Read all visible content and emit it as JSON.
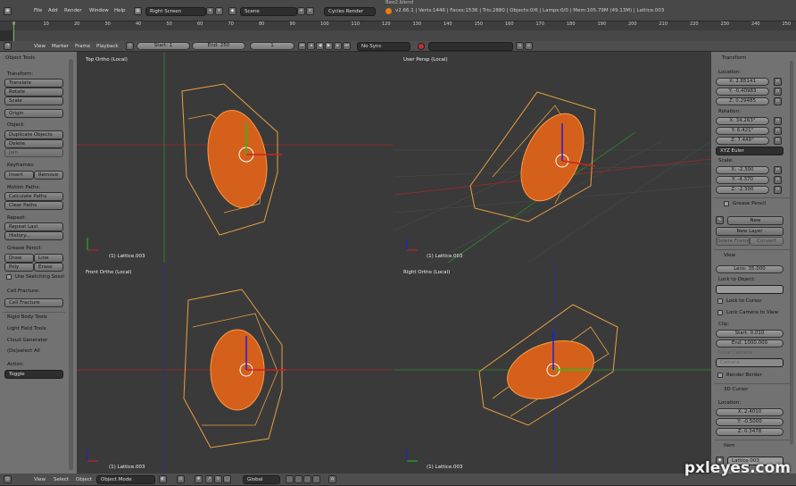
{
  "topbar": {
    "menus": [
      "File",
      "Add",
      "Render",
      "Window",
      "Help"
    ],
    "screen": "Right Screen",
    "scene": "Scene",
    "engine": "Cycles Render",
    "stats": "v2.66.1 | Verts:1446 | Faces:1536 | Tris:2880 | Objects:0/6 | Lamps:0/0 | Mem:105.79M (49.13M) | Lattice.003",
    "title": "Bee2.blend"
  },
  "timeline": {
    "ticks": [
      "0",
      "10",
      "20",
      "30",
      "40",
      "50",
      "60",
      "70",
      "80",
      "90",
      "100",
      "110",
      "120",
      "130",
      "140",
      "150",
      "160",
      "170",
      "180",
      "190",
      "200",
      "210",
      "220",
      "230",
      "240",
      "250"
    ],
    "menus": [
      "View",
      "Marker",
      "Frame",
      "Playback"
    ],
    "start": "Start: 1",
    "end": "End: 250",
    "current": "1",
    "sync": "No Sync"
  },
  "tools": {
    "header": "Object Tools",
    "transform_label": "Transform:",
    "transform": [
      "Translate",
      "Rotate",
      "Scale"
    ],
    "origin": "Origin",
    "object_label": "Object:",
    "object": [
      "Duplicate Objects",
      "Delete",
      "Join"
    ],
    "keyframes_label": "Keyframes:",
    "insert": "Insert",
    "remove": "Remove",
    "motion_label": "Motion Paths:",
    "motion": [
      "Calculate Paths",
      "Clear Paths"
    ],
    "repeat_label": "Repeat:",
    "repeat": [
      "Repeat Last",
      "History..."
    ],
    "gp_label": "Grease Pencil:",
    "draw": "Draw",
    "line": "Line",
    "poly": "Poly",
    "erase": "Erase",
    "sketch": "Use Sketching Sessi",
    "fracture_label": "Cell Fracture:",
    "fracture": "Cell Fracture",
    "panels": [
      "Rigid Body Tools",
      "Light Field Tools",
      "Cloud Generator",
      "(De)select All"
    ],
    "action_label": "Action:",
    "action": "Toggle"
  },
  "viewports": {
    "tl": {
      "name": "Top Ortho (Local)",
      "obj": "(1) Lattice.003"
    },
    "tr": {
      "name": "User Persp (Local)",
      "obj": "(1) Lattice.003"
    },
    "bl": {
      "name": "Front Ortho (Local)",
      "obj": "(1) Lattice.003"
    },
    "br": {
      "name": "Right Ortho (Local)",
      "obj": "(1) Lattice.003"
    }
  },
  "props": {
    "transform": "Transform",
    "location_label": "Location:",
    "location": [
      "X: 2.85141",
      "Y: -0.40983",
      "Z: 0.29485"
    ],
    "rotation_label": "Rotation:",
    "rotation": [
      "X: 34.263°",
      "Y: 6.421°",
      "Z: 7.449°"
    ],
    "rotmode": "XYZ Euler",
    "scale_label": "Scale:",
    "scale": [
      "X: -2.300",
      "Y: -4.370",
      "Z: -2.300"
    ],
    "gp": "Grease Pencil",
    "new": "New",
    "new_layer": "New Layer",
    "delete_frame": "Delete Frame",
    "convert": "Convert",
    "view": "View",
    "lens": "Lens: 35.000",
    "lock_obj": "Lock to Object:",
    "lock_cursor": "Lock to Cursor",
    "lock_cam": "Lock Camera to View",
    "clip": "Clip:",
    "clip_start": "Start: 0.010",
    "clip_end": "End: 1000.000",
    "local_cam": "Local Camera:",
    "camera": "Camera",
    "render_border": "Render Border",
    "cursor": "3D Cursor",
    "cursor_loc": "Location:",
    "cursor_vals": [
      "X: 2.4010",
      "Y: -0.5000",
      "Z: 0.3478"
    ],
    "item": "Item",
    "item_name": "Lattice.003"
  },
  "bottombar": {
    "menus": [
      "View",
      "Select",
      "Object"
    ],
    "mode": "Object Mode",
    "orient": "Global"
  },
  "watermark": "pxleyes.com"
}
